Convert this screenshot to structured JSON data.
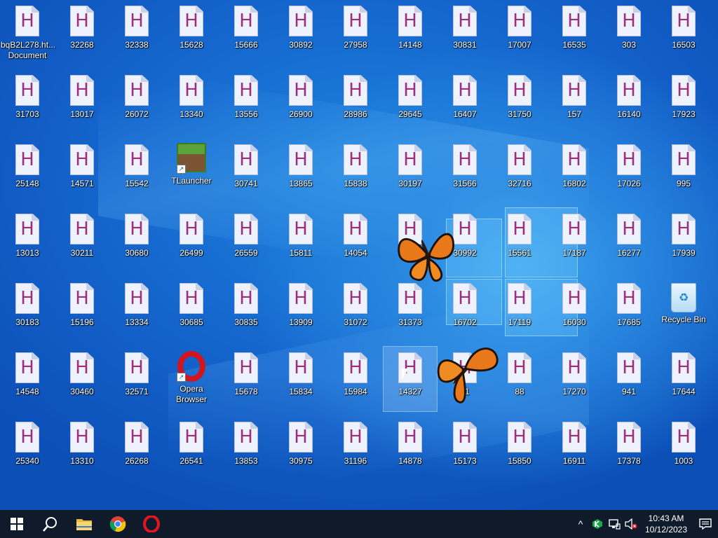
{
  "desktop": {
    "icons": [
      [
        "bqB2L278.ht... Document",
        "32268",
        "32338",
        "15628",
        "15666",
        "30892",
        "27958",
        "14148",
        "30831",
        "17007",
        "16535",
        "303",
        "16503"
      ],
      [
        "31703",
        "13017",
        "26072",
        "13340",
        "13556",
        "26900",
        "28986",
        "29645",
        "16407",
        "31750",
        "157",
        "16140",
        "17923"
      ],
      [
        "25148",
        "14571",
        "15542",
        "TLauncher",
        "30741",
        "13865",
        "15838",
        "30197",
        "31566",
        "32716",
        "16802",
        "17026",
        "995"
      ],
      [
        "13013",
        "30211",
        "30680",
        "26499",
        "26559",
        "15811",
        "14054",
        "",
        "30992",
        "15561",
        "17187",
        "16277",
        "17939"
      ],
      [
        "30183",
        "15196",
        "13334",
        "30685",
        "30835",
        "13909",
        "31072",
        "31373",
        "16702",
        "17119",
        "16030",
        "17685",
        "Recycle Bin"
      ],
      [
        "14548",
        "30460",
        "32571",
        "Opera Browser",
        "15678",
        "15834",
        "15984",
        "14327",
        "21",
        "88",
        "17270",
        "941",
        "17644"
      ],
      [
        "25340",
        "13310",
        "26268",
        "26541",
        "13853",
        "30975",
        "31196",
        "14878",
        "15173",
        "15850",
        "16911",
        "17378",
        "1003"
      ]
    ],
    "selected_icon": "14327",
    "doc_letter": "H"
  },
  "taskbar": {
    "start_icon": "windows-logo",
    "search_icon": "search",
    "pinned": [
      "File Explorer",
      "Google Chrome",
      "Opera"
    ],
    "tray": {
      "show_hidden_icon": "^",
      "network_icon": "network",
      "volume_icon": "volume-muted"
    },
    "clock": {
      "time": "10:43 AM",
      "date": "10/12/2023"
    }
  },
  "colors": {
    "accent": "#1464cc",
    "taskbar": "#0f1b2a",
    "doc_letter": "#9b2f7a"
  }
}
